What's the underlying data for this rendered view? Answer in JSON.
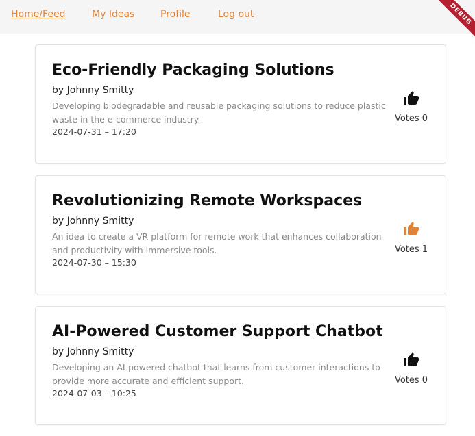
{
  "nav": {
    "home_feed": "Home/Feed",
    "my_ideas": "My Ideas",
    "profile": "Profile",
    "logout": "Log out",
    "debug_banner": "DEBUG"
  },
  "colors": {
    "accent": "#e0843a",
    "liked_icon": "#e0843a",
    "default_icon": "#111111",
    "debug_banner": "#b4202f"
  },
  "ideas": [
    {
      "title": "Eco-Friendly Packaging Solutions",
      "author": "by Johnny Smitty",
      "description": "Developing biodegradable and reusable packaging solutions to reduce plastic waste in the e-commerce industry.",
      "date": "2024-07-31 – 17:20",
      "votes": "Votes 0",
      "vote_icon": "thumbs-up-icon",
      "liked": false
    },
    {
      "title": "Revolutionizing Remote Workspaces",
      "author": "by Johnny Smitty",
      "description": "An idea to create a VR platform for remote work that enhances collaboration and productivity with immersive tools.",
      "date": "2024-07-30 – 15:30",
      "votes": "Votes 1",
      "vote_icon": "thumbs-up-icon",
      "liked": true
    },
    {
      "title": "AI-Powered Customer Support Chatbot",
      "author": "by Johnny Smitty",
      "description": "Developing an AI-powered chatbot that learns from customer interactions to provide more accurate and efficient support.",
      "date": "2024-07-03 – 10:25",
      "votes": "Votes 0",
      "vote_icon": "thumbs-up-icon",
      "liked": false
    }
  ]
}
